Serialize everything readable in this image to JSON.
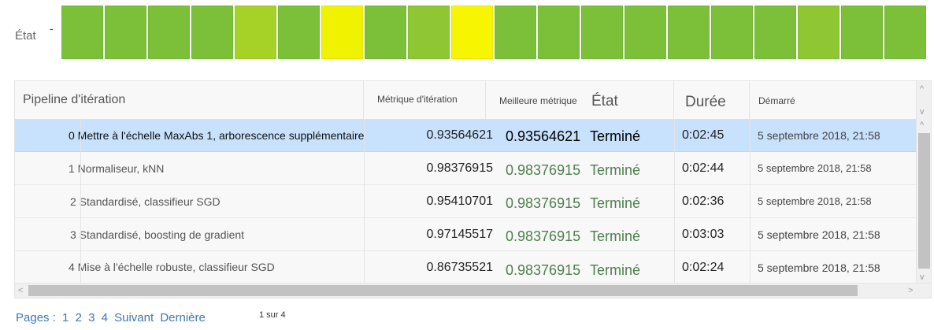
{
  "status": {
    "label": "État",
    "dash": "-",
    "cells": [
      "#7cc03a",
      "#7cc03a",
      "#7cc03a",
      "#7cc03a",
      "#a6d127",
      "#7cc03a",
      "#f0f200",
      "#7cc03a",
      "#8ec634",
      "#f7f600",
      "#7cc03a",
      "#7cc03a",
      "#7cc03a",
      "#7cc03a",
      "#7cc03a",
      "#7cc03a",
      "#7cc03a",
      "#8ec634",
      "#7cc03a",
      "#7cc03a"
    ]
  },
  "table": {
    "headers": {
      "pipeline": "Pipeline d'itération",
      "metric": "Métrique d'itération",
      "best": "Meilleure métrique",
      "state": "État",
      "duration": "Durée",
      "started": "Démarré"
    },
    "rows": [
      {
        "pipeline": "0 Mettre à l'échelle MaxAbs 1, arborescence supplémentaire",
        "metric": "0.93564621",
        "best": "0.93564621",
        "state": "Terminé",
        "duration": "0:02:45",
        "started": "5 septembre 2018, 21:58"
      },
      {
        "pipeline": "1 Normaliseur, kNN",
        "metric": "0.98376915",
        "best": "0.98376915",
        "state": "Terminé",
        "duration": "0:02:44",
        "started": "5 septembre 2018, 21:58"
      },
      {
        "pipeline": "2 Standardisé, classifieur SGD",
        "metric": "0.95410701",
        "best": "0.98376915",
        "state": "Terminé",
        "duration": "0:02:36",
        "started": "5 septembre 2018, 21:58"
      },
      {
        "pipeline": "3 Standardisé, boosting de gradient",
        "metric": "0.97145517",
        "best": "0.98376915",
        "state": "Terminé",
        "duration": "0:03:03",
        "started": "5 septembre 2018, 21:58"
      },
      {
        "pipeline": "4 Mise à l'échelle robuste, classifieur SGD",
        "metric": "0.86735521",
        "best": "0.98376915",
        "state": "Terminé",
        "duration": "0:02:24",
        "started": "5 septembre 2018, 21:58"
      }
    ]
  },
  "scroll": {
    "up": "^",
    "down": "v",
    "left": "<",
    "right": ">"
  },
  "pager": {
    "prefix": "Pages :",
    "pages": [
      "1",
      "2",
      "3",
      "4"
    ],
    "next": "Suivant",
    "last": "Dernière",
    "count": "1 sur 4"
  }
}
